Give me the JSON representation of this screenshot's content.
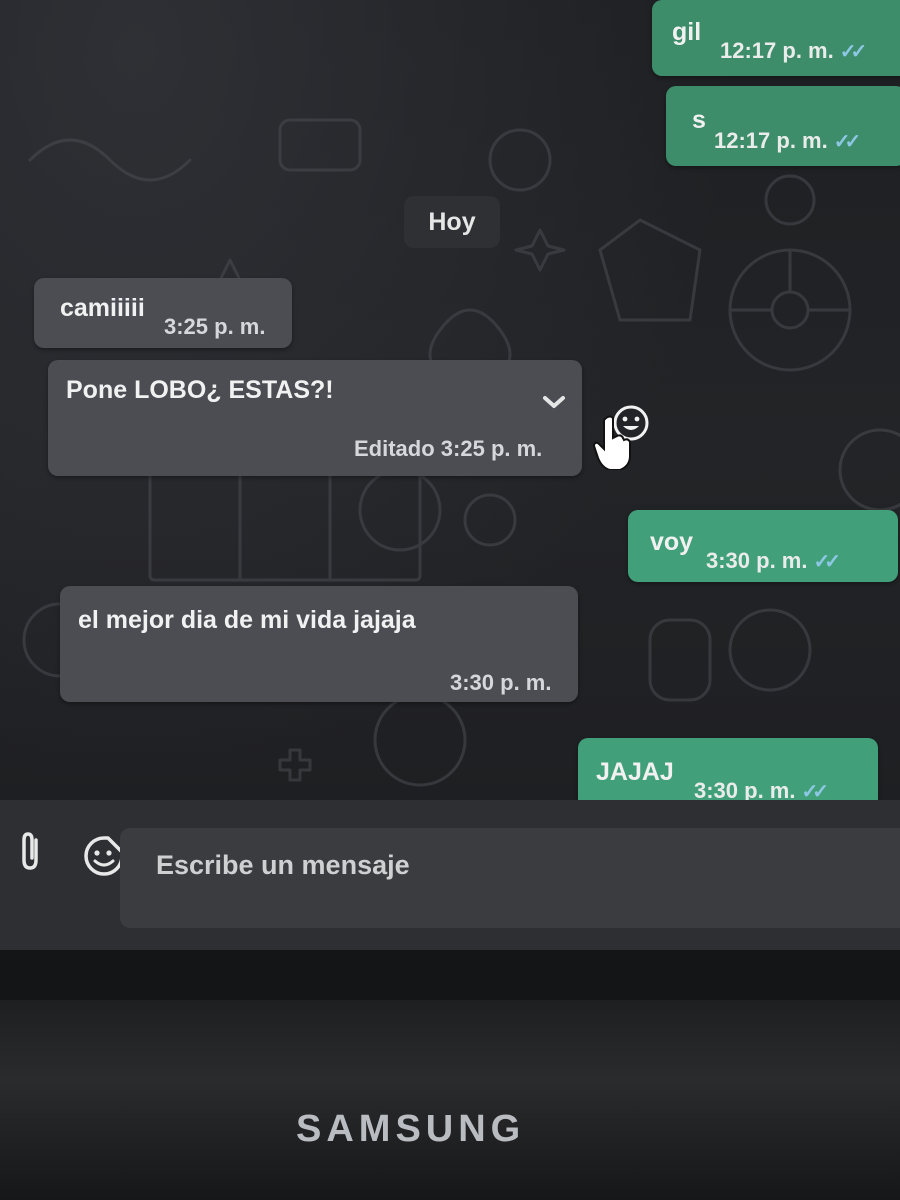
{
  "chat": {
    "day_separator": "Hoy",
    "messages": [
      {
        "side": "out",
        "text": "gil",
        "time": "12:17 p. m.",
        "ticks": "✓✓"
      },
      {
        "side": "out",
        "text": "s",
        "time": "12:17 p. m.",
        "ticks": "✓✓"
      },
      {
        "side": "in",
        "text": "camiiiii",
        "time": "3:25 p. m."
      },
      {
        "side": "in",
        "text": "Pone LOBO¿ ESTAS?!",
        "edited": "Editado",
        "time": "3:25 p. m."
      },
      {
        "side": "out",
        "text": "voy",
        "time": "3:30 p. m.",
        "ticks": "✓✓"
      },
      {
        "side": "in",
        "text": "el mejor dia de mi vida jajaja",
        "time": "3:30 p. m."
      },
      {
        "side": "out",
        "text": "JAJAJ",
        "time": "3:30 p. m.",
        "ticks": "✓✓"
      }
    ]
  },
  "composer": {
    "placeholder": "Escribe un mensaje",
    "attach_icon": "paperclip-icon",
    "emoji_icon": "sticker-icon"
  },
  "monitor": {
    "brand": "SAMSUNG"
  },
  "colors": {
    "incoming_bubble": "#4b4d53",
    "outgoing_bubble": "#3d8d6a",
    "read_ticks": "#8ec7e3",
    "background": "#232427"
  }
}
